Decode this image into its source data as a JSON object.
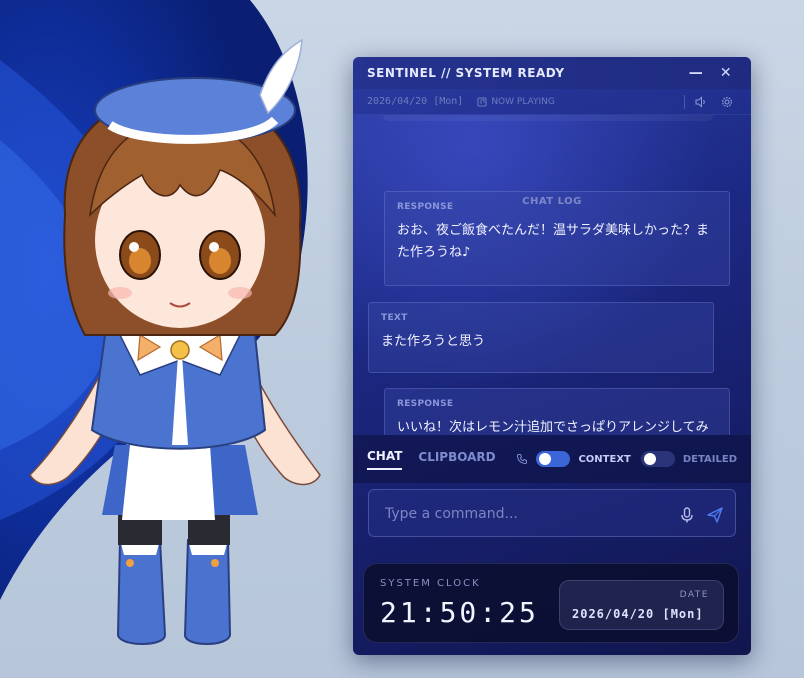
{
  "window": {
    "title": "SENTINEL // SYSTEM READY",
    "minimize": "—",
    "close": "✕"
  },
  "subbar": {
    "date": "2026/04/20 [Mon]",
    "now_playing": "NOW PLAYING"
  },
  "chat": {
    "section_label": "CHAT LOG",
    "messages": [
      {
        "label": "RESPONSE",
        "text": "おお、夜ご飯食べたんだ！温サラダ美味しかった？また作ろうね♪"
      },
      {
        "label": "TEXT",
        "text": "また作ろうと思う"
      },
      {
        "label": "RESPONSE",
        "text": "いいね！次はレモン汁追加でさっぱりアレンジしてみようか♪"
      }
    ]
  },
  "tabs": {
    "chat": "CHAT",
    "clipboard": "CLIPBOARD",
    "context_label": "CONTEXT",
    "detailed_label": "DETAILED"
  },
  "input": {
    "placeholder": "Type a command..."
  },
  "clock": {
    "label": "SYSTEM CLOCK",
    "time": "21:50:25",
    "date_label": "DATE",
    "date_value": "2026/04/20 [Mon]"
  },
  "colors": {
    "accent": "#3b66d8",
    "panel_bg": "#1d2a86"
  }
}
